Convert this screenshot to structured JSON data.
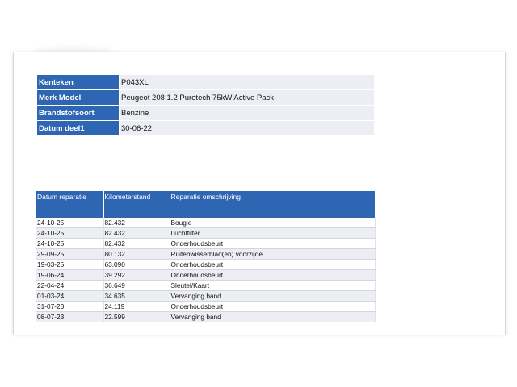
{
  "vehicle": {
    "rows": [
      {
        "label": "Kenteken",
        "value": "P043XL"
      },
      {
        "label": "Merk Model",
        "value": "Peugeot 208 1.2 Puretech 75kW  Active Pack"
      },
      {
        "label": "Brandstofsoort",
        "value": "Benzine"
      },
      {
        "label": "Datum deel1",
        "value": "30-06-22"
      }
    ]
  },
  "repairs": {
    "headers": [
      "Datum reparatie",
      "Kilometerstand",
      "Reparatie omschrijving"
    ],
    "rows": [
      [
        "24-10-25",
        "82.432",
        "Bougie"
      ],
      [
        "24-10-25",
        "82.432",
        "Luchtfilter"
      ],
      [
        "24-10-25",
        "82.432",
        "Onderhoudsbeurt"
      ],
      [
        "29-09-25",
        "80.132",
        "Ruitenwisserblad(en) voorzijde"
      ],
      [
        "19-03-25",
        "63.090",
        "Onderhoudsbeurt"
      ],
      [
        "19-06-24",
        "39.292",
        "Onderhoudsbeurt"
      ],
      [
        "22-04-24",
        "36.649",
        "Sleutel/Kaart"
      ],
      [
        "01-03-24",
        "34.635",
        "Vervanging band"
      ],
      [
        "31-07-23",
        "24.119",
        "Onderhoudsbeurt"
      ],
      [
        "08-07-23",
        "22.599",
        "Vervanging band"
      ]
    ]
  },
  "colors": {
    "header_blue": "#2f66b3",
    "row_shade": "#edeef3"
  }
}
